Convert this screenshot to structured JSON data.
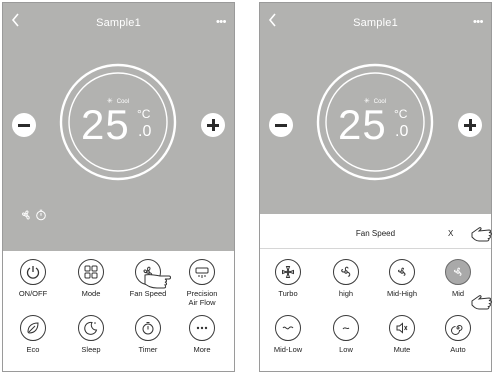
{
  "left_screen": {
    "header": {
      "title": "Sample1"
    },
    "dial": {
      "mode_label": "Cool",
      "temperature": "25",
      "decimal": ".0",
      "unit": "°C"
    },
    "buttons": [
      {
        "label": "ON/OFF",
        "icon": "power-icon"
      },
      {
        "label": "Mode",
        "icon": "mode-icon"
      },
      {
        "label": "Fan Speed",
        "icon": "fan-icon"
      },
      {
        "label": "Precision",
        "label2": "Air Flow",
        "icon": "airflow-icon"
      },
      {
        "label": "Eco",
        "icon": "eco-leaf-icon"
      },
      {
        "label": "Sleep",
        "icon": "sleep-moon-icon"
      },
      {
        "label": "Timer",
        "icon": "timer-icon"
      },
      {
        "label": "More",
        "icon": "more-dots-icon"
      }
    ]
  },
  "right_screen": {
    "header": {
      "title": "Sample1"
    },
    "dial": {
      "mode_label": "Cool",
      "temperature": "25",
      "decimal": ".0",
      "unit": "°C"
    },
    "fan_speed_sheet": {
      "title": "Fan Speed",
      "close_label": "X",
      "options": [
        {
          "label": "Turbo",
          "icon": "fan-turbo-icon"
        },
        {
          "label": "high",
          "icon": "fan-high-icon"
        },
        {
          "label": "Mid-High",
          "icon": "fan-mid-high-icon"
        },
        {
          "label": "Mid",
          "icon": "fan-mid-icon",
          "selected": true
        },
        {
          "label": "Mid-Low",
          "icon": "fan-mid-low-icon"
        },
        {
          "label": "Low",
          "icon": "fan-low-icon"
        },
        {
          "label": "Mute",
          "icon": "mute-icon"
        },
        {
          "label": "Auto",
          "icon": "fan-auto-icon"
        }
      ]
    }
  },
  "colors": {
    "panel_grey": "#b2b2b0",
    "selected_grey": "#a9a9a9",
    "icon_dark": "#3a3a3a"
  }
}
